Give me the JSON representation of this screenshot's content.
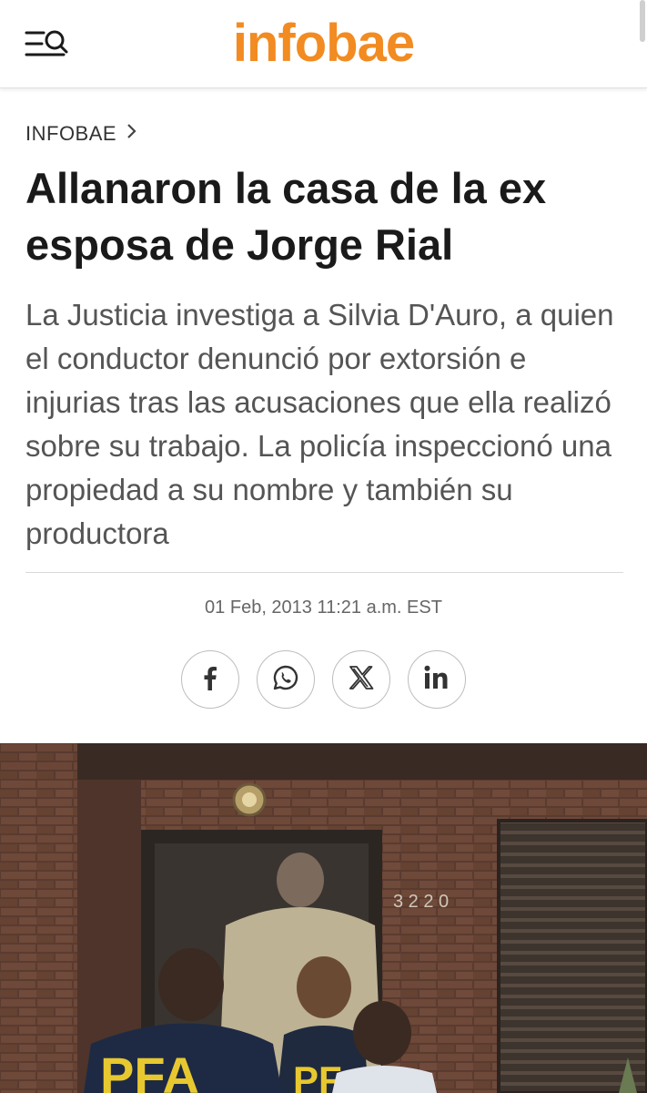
{
  "header": {
    "logo": "infobae",
    "menu_icon": "menu-search-icon",
    "brand_color": "#f28b21"
  },
  "article": {
    "breadcrumb": "INFOBAE",
    "breadcrumb_icon": "chevron-right-icon",
    "title": "Allanaron la casa de la ex esposa de Jorge Rial",
    "subtitle": "La Justicia investiga a Silvia D'Auro, a quien el conductor denunció por extorsión e injurias tras las acusaciones que ella realizó sobre su trabajo. La policía inspeccionó una propiedad a su nombre y también su productora",
    "date": "01 Feb, 2013 11:21 a.m. EST"
  },
  "share": [
    {
      "name": "facebook",
      "icon": "facebook-icon"
    },
    {
      "name": "whatsapp",
      "icon": "whatsapp-icon"
    },
    {
      "name": "x",
      "icon": "x-icon"
    },
    {
      "name": "linkedin",
      "icon": "linkedin-icon"
    }
  ],
  "photo": {
    "house_number": "3220",
    "jacket_text": "PFA"
  }
}
